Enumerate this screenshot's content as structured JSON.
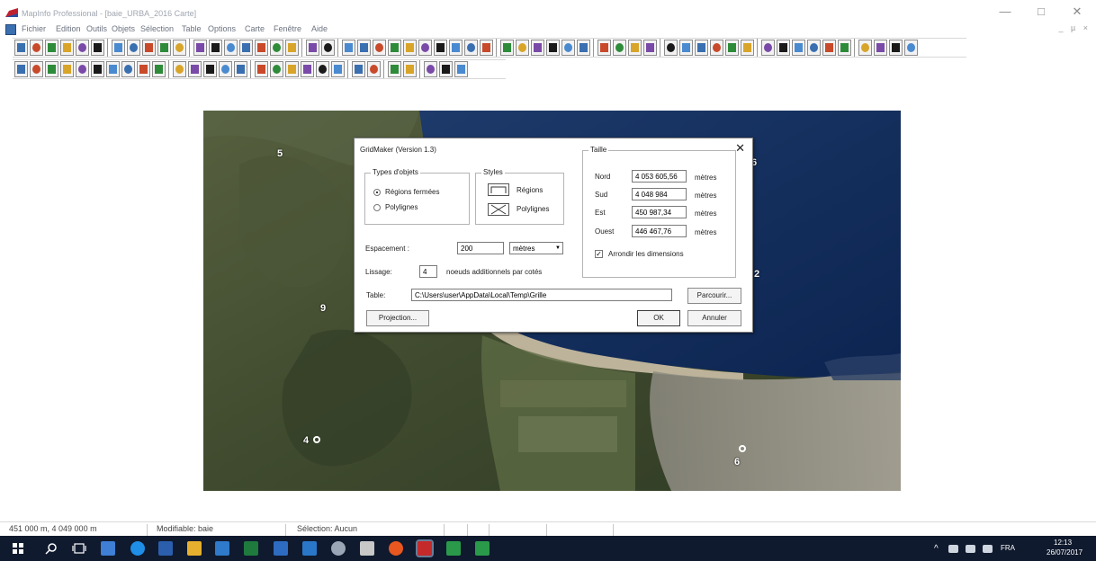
{
  "window": {
    "title": "MapInfo Professional - [baie_URBA_2016 Carte]",
    "controls": [
      "—",
      "□",
      "✕"
    ],
    "mdi_controls": "_ µ ×"
  },
  "menu": [
    "Fichier",
    "Edition",
    "Outils",
    "Objets",
    "Sélection",
    "Table",
    "Options",
    "Carte",
    "Fenêtre",
    "Aide"
  ],
  "map": {
    "labels": [
      "5",
      "9",
      "6",
      "2",
      "4",
      "6"
    ]
  },
  "dialog": {
    "title": "GridMaker (Version 1.3)",
    "close": "✕",
    "types_group": "Types d'objets",
    "types": [
      {
        "label": "Régions fermées",
        "selected": true
      },
      {
        "label": "Polylignes",
        "selected": false
      }
    ],
    "styles_group": "Styles",
    "styles": [
      {
        "label": "Régions",
        "icon": "region-style-icon"
      },
      {
        "label": "Polylignes",
        "icon": "polyline-style-icon"
      }
    ],
    "spacing": {
      "label": "Espacement :",
      "value": "200",
      "unit": "mètres"
    },
    "smoothing": {
      "label": "Lissage:",
      "value": "4",
      "suffix": "noeuds additionnels par cotés"
    },
    "size_group": "Taille",
    "size": [
      {
        "label": "Nord",
        "value": "4 053 605,56",
        "unit": "mètres"
      },
      {
        "label": "Sud",
        "value": "4 048 984",
        "unit": "mètres"
      },
      {
        "label": "Est",
        "value": "450 987,34",
        "unit": "mètres"
      },
      {
        "label": "Ouest",
        "value": "446 467,76",
        "unit": "mètres"
      }
    ],
    "round": {
      "label": "Arrondir les dimensions",
      "checked": true
    },
    "table": {
      "label": "Table:",
      "value": "C:\\Users\\user\\AppData\\Local\\Temp\\Grille",
      "browse": "Parcourir..."
    },
    "buttons": {
      "projection": "Projection...",
      "ok": "OK",
      "cancel": "Annuler"
    }
  },
  "status": {
    "coords": "451 000 m, 4 049 000 m",
    "editable": "Modifiable: baie",
    "selection": "Sélection: Aucun"
  },
  "taskbar": {
    "tray_lang": "FRA",
    "time": "12:13",
    "date": "26/07/2017"
  }
}
